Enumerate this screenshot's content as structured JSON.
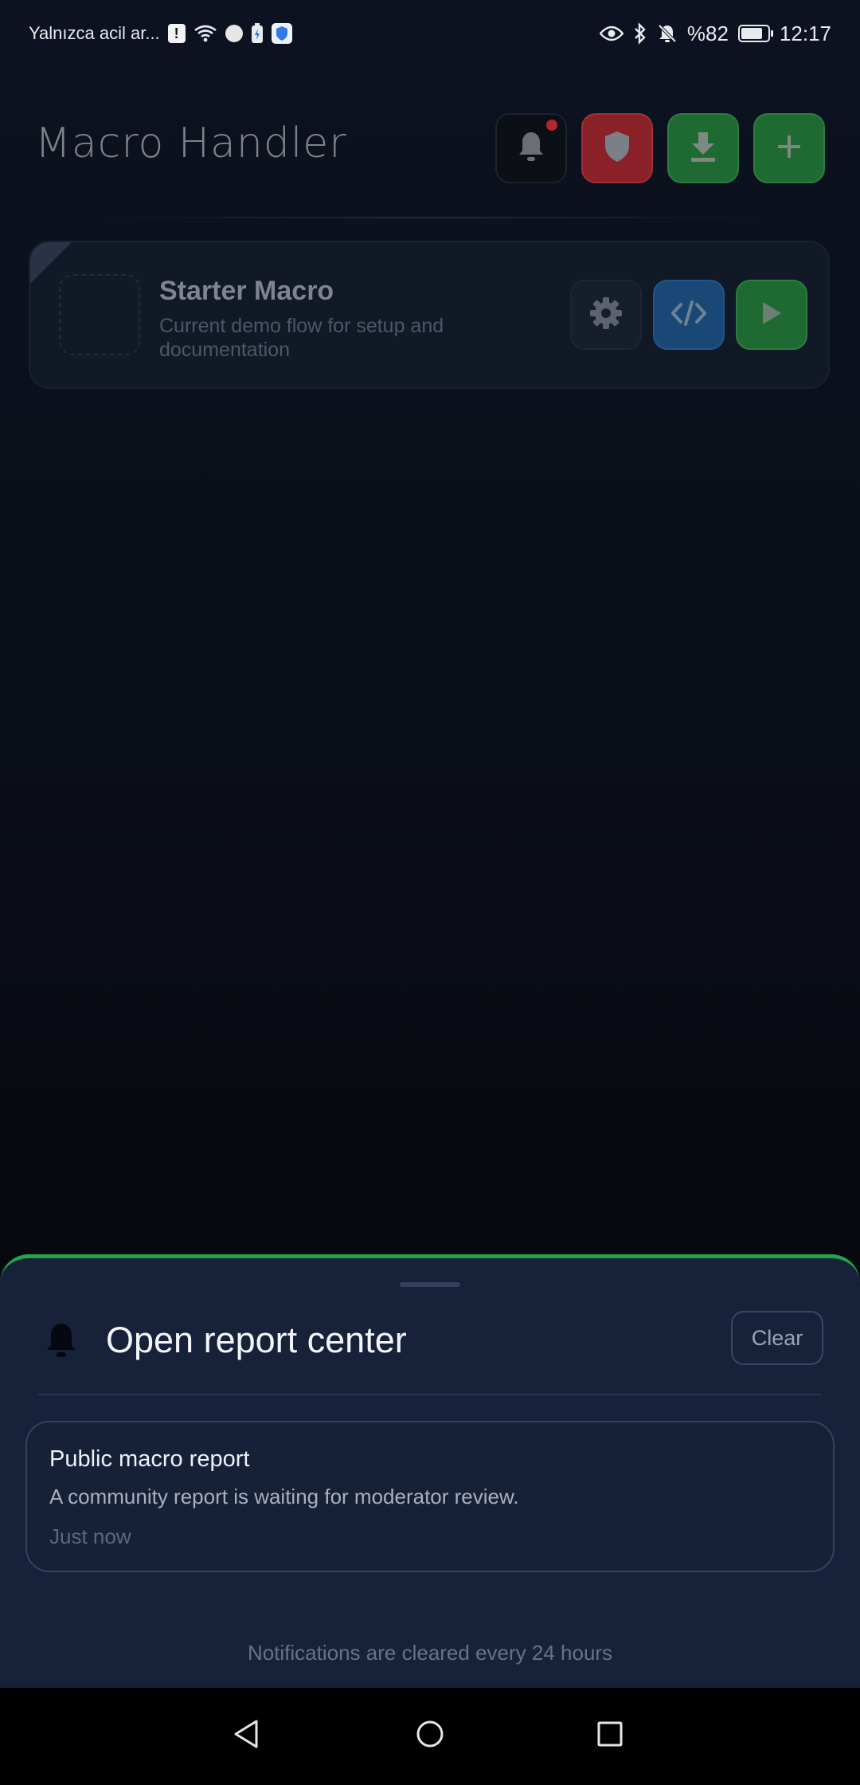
{
  "status_bar": {
    "carrier_text": "Yalnızca acil ar...",
    "battery_text": "%82",
    "battery_level": 0.82,
    "time": "12:17",
    "icons_left": [
      "alert-badge-icon",
      "wifi-icon",
      "app-circle-icon",
      "battery-saver-icon",
      "shield-app-icon"
    ],
    "icons_right": [
      "eye-icon",
      "bluetooth-icon",
      "muted-bell-icon",
      "battery-icon"
    ]
  },
  "header": {
    "title": "Macro Handler",
    "actions": [
      "bell-icon",
      "shield-icon",
      "download-icon",
      "plus-icon"
    ],
    "colors": {
      "shield_bg": "#8a2128",
      "green_bg": "#1f6a32",
      "notification_dot": "#b3262b"
    }
  },
  "macro_card": {
    "name": "Starter Macro",
    "description": "Current demo flow for setup and documentation",
    "actions": [
      "gear-icon",
      "code-icon",
      "play-icon"
    ]
  },
  "sheet": {
    "title": "Open report center",
    "clear_label": "Clear",
    "accent_color": "#23a44a",
    "notifications": [
      {
        "title": "Public macro report",
        "body": "A community report is waiting for moderator review.",
        "time": "Just now"
      }
    ],
    "footer": "Notifications are cleared every 24 hours"
  },
  "nav_bar": {
    "buttons": [
      "back-icon",
      "home-icon",
      "recents-icon"
    ]
  }
}
